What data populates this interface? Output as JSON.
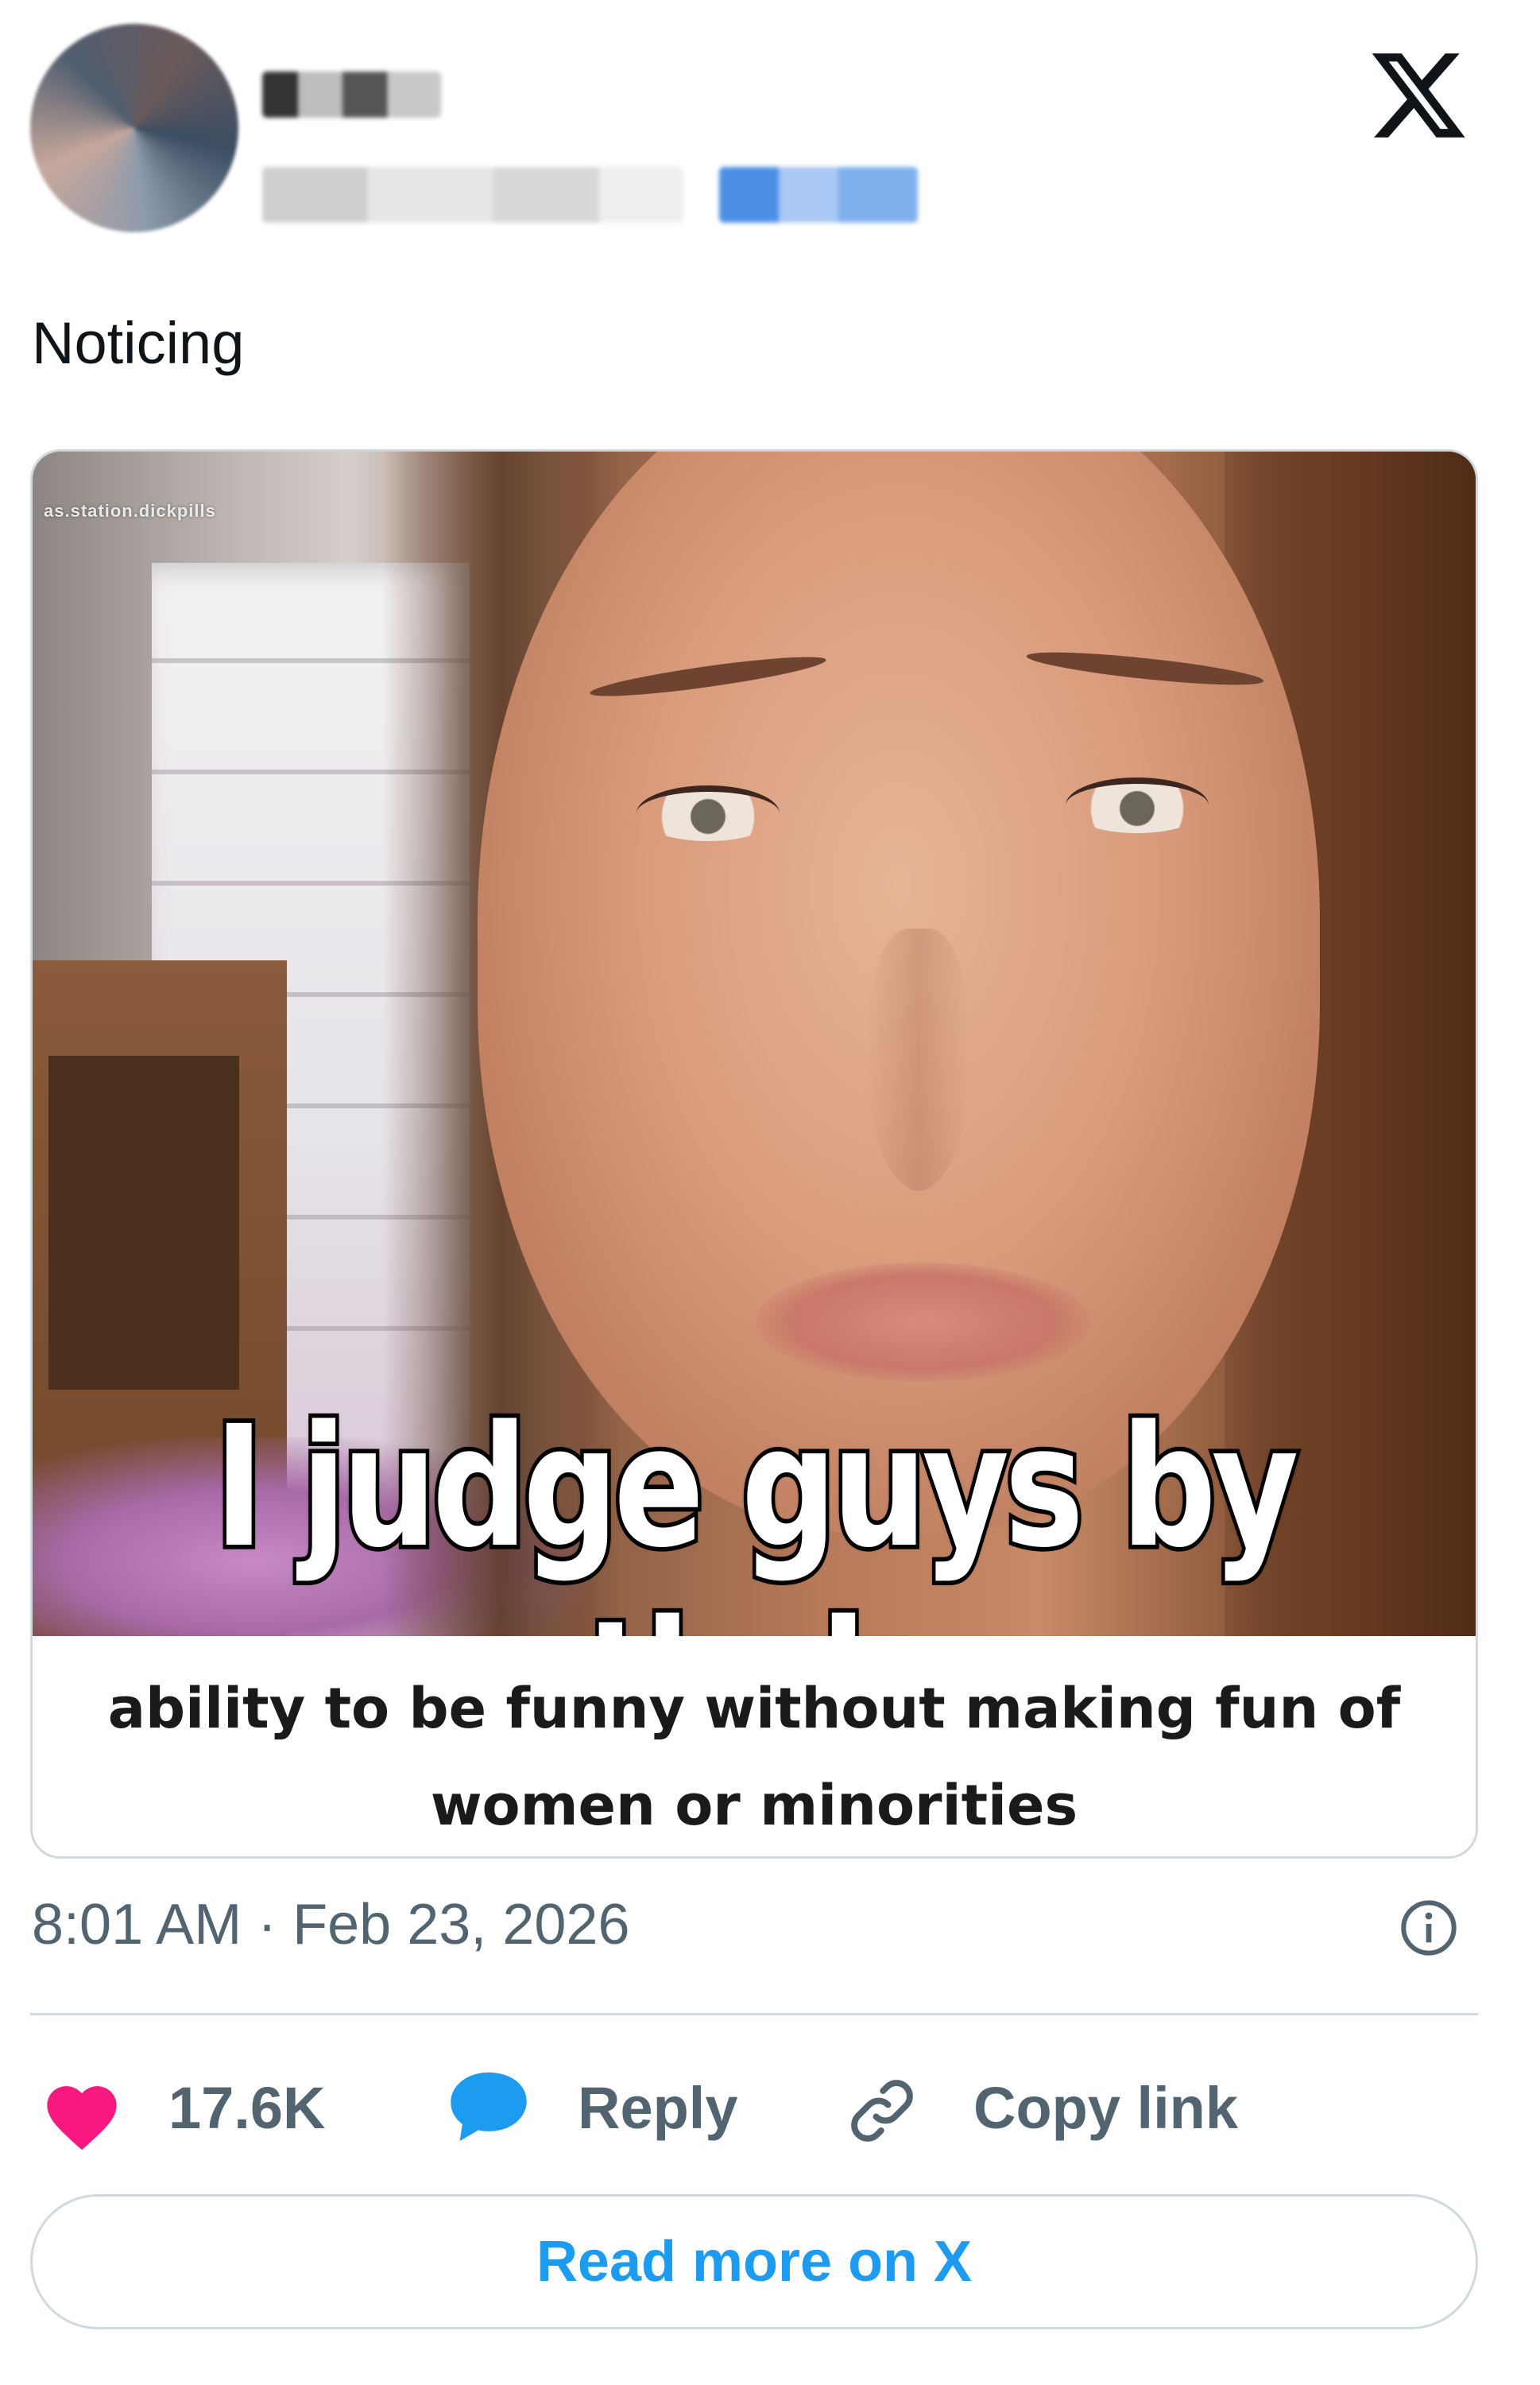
{
  "post": {
    "text": "Noticing",
    "timestamp": "8:01 AM · Feb 23, 2026"
  },
  "media": {
    "watermark": "as.station.dickpills",
    "meme_text": "I judge guys by their",
    "caption": "ability to be funny without making fun of women or minorities"
  },
  "actions": {
    "like_count": "17.6K",
    "reply_label": "Reply",
    "copy_link_label": "Copy link"
  },
  "read_more_label": "Read more on X",
  "colors": {
    "like": "#f91880",
    "reply": "#1d9bf0",
    "link_text": "#1d9bf0",
    "muted_text": "#536471",
    "border": "#cfd9de"
  },
  "icons": {
    "brand": "x-logo-icon",
    "info": "info-icon",
    "like": "heart-icon",
    "reply": "speech-bubble-icon",
    "copy_link": "link-icon"
  }
}
